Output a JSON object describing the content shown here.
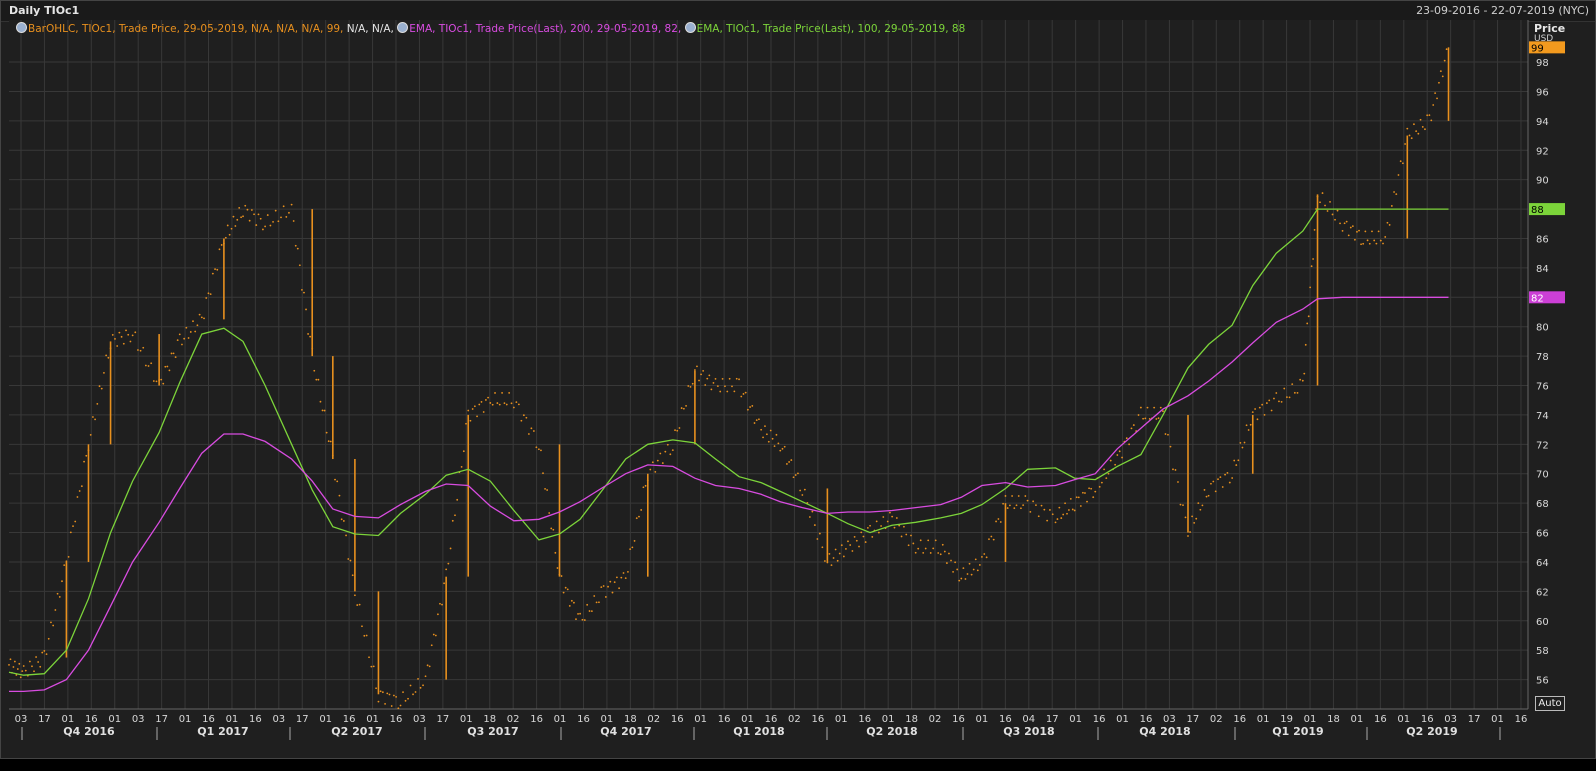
{
  "window": {
    "title": "Daily TIOc1",
    "date_range": "23-09-2016 - 22-07-2019 (NYC)",
    "auto_label": "Auto"
  },
  "legend": [
    {
      "parts": [
        {
          "text": "BarOHLC, TIOc1, Trade Price,  29-05-2019, N/A, N/A, N/A, 99, ",
          "color": "#e8901e"
        },
        {
          "text": "N/A, N/A, ",
          "color": "#e6e6e6"
        }
      ]
    },
    {
      "parts": [
        {
          "text": "EMA, TIOc1, Trade Price(Last),  200,  29-05-2019, 82, ",
          "color": "#d84ce0"
        }
      ]
    },
    {
      "parts": [
        {
          "text": "EMA, TIOc1, Trade Price(Last),  100,  29-05-2019, 88",
          "color": "#7cd43a"
        }
      ]
    }
  ],
  "axis": {
    "price_label": "Price",
    "currency_label": "USD",
    "y_ticks": [
      "98",
      "96",
      "94",
      "92",
      "90",
      "88",
      "86",
      "84",
      "82",
      "80",
      "78",
      "76",
      "74",
      "72",
      "70",
      "68",
      "66",
      "64",
      "62",
      "60",
      "58",
      "56"
    ],
    "x_day_ticks": [
      "03",
      "17",
      "01",
      "16",
      "01",
      "03",
      "17",
      "01",
      "16",
      "01",
      "16",
      "03",
      "17",
      "01",
      "16",
      "01",
      "16",
      "03",
      "17",
      "01",
      "18",
      "02",
      "16",
      "01",
      "16",
      "01",
      "18",
      "02",
      "16",
      "01",
      "16",
      "01",
      "16",
      "02",
      "16",
      "01",
      "16",
      "01",
      "18",
      "02",
      "16",
      "01",
      "16",
      "04",
      "17",
      "01",
      "16",
      "01",
      "16",
      "03",
      "17",
      "02",
      "16",
      "01",
      "19",
      "01",
      "18",
      "01",
      "16",
      "01",
      "16",
      "03",
      "17",
      "01",
      "16"
    ],
    "quarters": [
      "Q4 2016",
      "Q1 2017",
      "Q2 2017",
      "Q3 2017",
      "Q4 2017",
      "Q1 2018",
      "Q2 2018",
      "Q3 2018",
      "Q4 2018",
      "Q1 2019",
      "Q2 2019"
    ]
  },
  "last_value_badges": [
    {
      "label": "99",
      "bg": "#f39a1e",
      "fg": "#000000"
    },
    {
      "label": "88",
      "bg": "#7cd43a",
      "fg": "#000000"
    },
    {
      "label": "82",
      "bg": "#cc3fd6",
      "fg": "#ffffff"
    }
  ],
  "colors": {
    "background": "#1f1f1f",
    "grid": "#383838",
    "price": "#e8901e",
    "ema100": "#7cd43a",
    "ema200": "#d84ce0"
  },
  "chart_data": {
    "type": "line",
    "title": "Daily TIOc1",
    "ylabel": "Price",
    "yunit": "USD",
    "ylim": [
      54,
      99.5
    ],
    "x": [
      "2016-09-23",
      "2016-10-03",
      "2016-10-17",
      "2016-11-01",
      "2016-11-16",
      "2016-12-01",
      "2016-12-16",
      "2017-01-03",
      "2017-01-17",
      "2017-02-01",
      "2017-02-16",
      "2017-03-01",
      "2017-03-16",
      "2017-04-03",
      "2017-04-17",
      "2017-05-01",
      "2017-05-16",
      "2017-06-01",
      "2017-06-16",
      "2017-07-03",
      "2017-07-17",
      "2017-08-01",
      "2017-08-16",
      "2017-09-01",
      "2017-09-18",
      "2017-10-02",
      "2017-10-16",
      "2017-11-01",
      "2017-11-16",
      "2017-12-01",
      "2017-12-18",
      "2018-01-02",
      "2018-01-16",
      "2018-02-01",
      "2018-02-16",
      "2018-03-01",
      "2018-03-16",
      "2018-04-02",
      "2018-04-16",
      "2018-05-01",
      "2018-05-16",
      "2018-06-01",
      "2018-06-18",
      "2018-07-02",
      "2018-07-16",
      "2018-08-01",
      "2018-08-16",
      "2018-09-04",
      "2018-09-17",
      "2018-10-01",
      "2018-10-16",
      "2018-11-01",
      "2018-11-16",
      "2018-12-03",
      "2018-12-17",
      "2019-01-02",
      "2019-01-16",
      "2019-02-01",
      "2019-02-19",
      "2019-03-01",
      "2019-03-18",
      "2019-04-01",
      "2019-04-16",
      "2019-05-01",
      "2019-05-16",
      "2019-05-29"
    ],
    "series": [
      {
        "name": "TIOc1",
        "values": [
          57.0,
          56.5,
          57.5,
          64,
          72,
          79,
          79.5,
          76,
          79,
          80.5,
          86,
          88,
          87,
          88,
          78,
          71,
          62,
          55,
          54.5,
          56,
          63,
          74,
          75,
          75,
          72,
          63,
          60,
          62,
          63,
          70,
          72,
          77,
          76,
          76,
          73,
          72,
          69,
          64,
          65,
          66,
          67,
          65,
          65,
          63,
          64,
          68,
          68,
          67,
          68,
          69,
          71,
          74,
          74,
          66,
          69,
          70,
          74,
          75,
          76,
          89,
          87,
          86,
          86,
          93,
          94,
          99
        ]
      },
      {
        "name": "EMA 200",
        "values": [
          55.2,
          55.2,
          55.3,
          56,
          58,
          61,
          64,
          66.7,
          69,
          71.4,
          72.7,
          72.7,
          72.2,
          71,
          69.5,
          67.6,
          67.1,
          67.0,
          67.9,
          68.8,
          69.3,
          69.2,
          67.8,
          66.8,
          66.9,
          67.4,
          68.1,
          69.1,
          70.0,
          70.6,
          70.5,
          69.7,
          69.2,
          69.0,
          68.6,
          68.1,
          67.7,
          67.3,
          67.4,
          67.4,
          67.5,
          67.7,
          67.9,
          68.4,
          69.2,
          69.4,
          69.1,
          69.2,
          69.6,
          70.0,
          71.7,
          73.1,
          74.4,
          75.3,
          76.3,
          77.6,
          78.9,
          80.3,
          81.2,
          81.9,
          82.0,
          82.0,
          82.0,
          82.0,
          82.0,
          82.0
        ]
      },
      {
        "name": "EMA 100",
        "values": [
          56.5,
          56.3,
          56.4,
          58,
          61.5,
          66,
          69.5,
          72.8,
          76.2,
          79.5,
          79.9,
          79.0,
          76.0,
          72.0,
          68.9,
          66.4,
          65.9,
          65.8,
          67.3,
          68.6,
          69.9,
          70.3,
          69.5,
          67.5,
          65.5,
          65.9,
          66.9,
          69.0,
          71.0,
          72.0,
          72.3,
          72.1,
          71.0,
          69.8,
          69.4,
          68.8,
          68.1,
          67.3,
          66.6,
          66.0,
          66.5,
          66.7,
          67.0,
          67.3,
          67.9,
          69.0,
          70.3,
          70.4,
          69.7,
          69.6,
          70.5,
          71.3,
          74.0,
          77.2,
          78.8,
          80.1,
          82.8,
          85.0,
          86.5,
          88.0,
          88.0,
          88.0,
          88.0,
          88.0,
          88.0,
          88.0
        ]
      }
    ],
    "grid": true,
    "legend": "top-left"
  }
}
